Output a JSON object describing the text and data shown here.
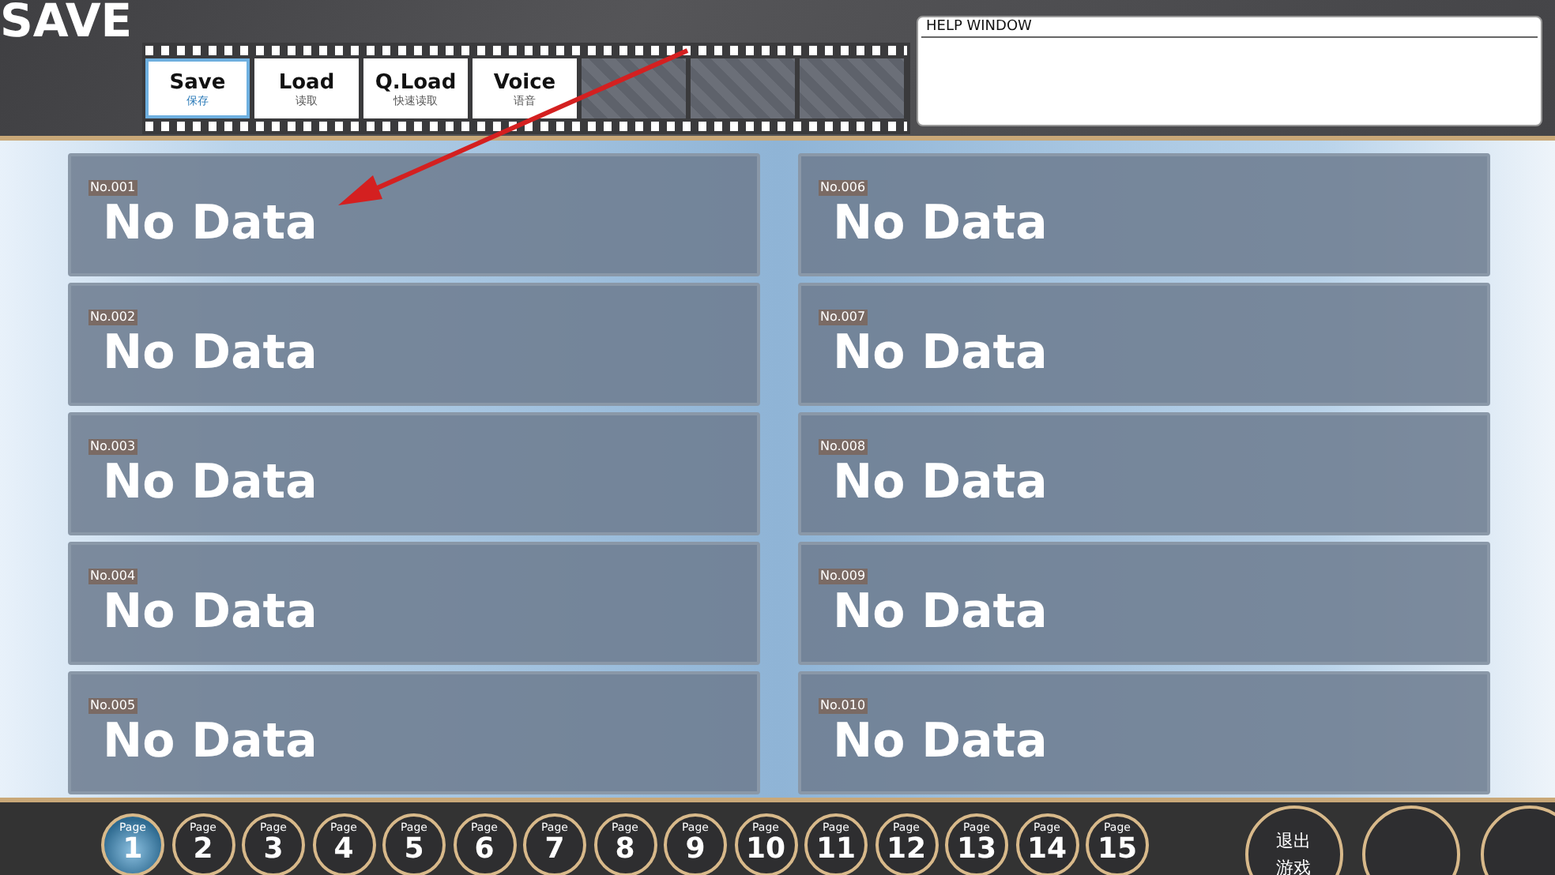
{
  "title": "SAVE",
  "tabs": [
    {
      "label": "Save",
      "sublabel": "保存",
      "selected": true
    },
    {
      "label": "Load",
      "sublabel": "读取",
      "selected": false
    },
    {
      "label": "Q.Load",
      "sublabel": "快速读取",
      "selected": false
    },
    {
      "label": "Voice",
      "sublabel": "语音",
      "selected": false
    }
  ],
  "help_window": {
    "title": "HELP WINDOW"
  },
  "slots": [
    {
      "number": "No.001",
      "status": "No Data"
    },
    {
      "number": "No.002",
      "status": "No Data"
    },
    {
      "number": "No.003",
      "status": "No Data"
    },
    {
      "number": "No.004",
      "status": "No Data"
    },
    {
      "number": "No.005",
      "status": "No Data"
    },
    {
      "number": "No.006",
      "status": "No Data"
    },
    {
      "number": "No.007",
      "status": "No Data"
    },
    {
      "number": "No.008",
      "status": "No Data"
    },
    {
      "number": "No.009",
      "status": "No Data"
    },
    {
      "number": "No.010",
      "status": "No Data"
    }
  ],
  "pages": [
    {
      "label": "Page",
      "number": "1",
      "selected": true
    },
    {
      "label": "Page",
      "number": "2",
      "selected": false
    },
    {
      "label": "Page",
      "number": "3",
      "selected": false
    },
    {
      "label": "Page",
      "number": "4",
      "selected": false
    },
    {
      "label": "Page",
      "number": "5",
      "selected": false
    },
    {
      "label": "Page",
      "number": "6",
      "selected": false
    },
    {
      "label": "Page",
      "number": "7",
      "selected": false
    },
    {
      "label": "Page",
      "number": "8",
      "selected": false
    },
    {
      "label": "Page",
      "number": "9",
      "selected": false
    },
    {
      "label": "Page",
      "number": "10",
      "selected": false
    },
    {
      "label": "Page",
      "number": "11",
      "selected": false
    },
    {
      "label": "Page",
      "number": "12",
      "selected": false
    },
    {
      "label": "Page",
      "number": "13",
      "selected": false
    },
    {
      "label": "Page",
      "number": "14",
      "selected": false
    },
    {
      "label": "Page",
      "number": "15",
      "selected": false
    }
  ],
  "exit_button": {
    "lines": [
      "退出",
      "游戏"
    ]
  }
}
